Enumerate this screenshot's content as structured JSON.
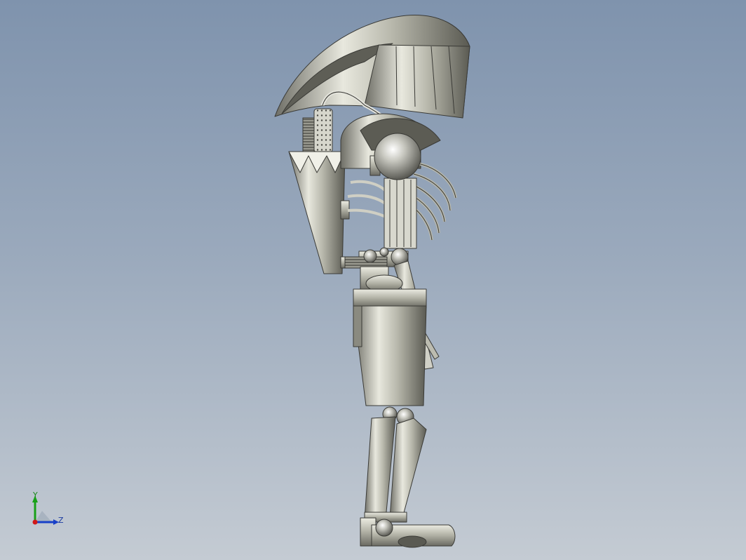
{
  "viewport": {
    "background_top": "#7f93ad",
    "background_bottom": "#c4cbd3"
  },
  "model": {
    "name": "battle-droid-side-view",
    "material_color": "#c8c8bc",
    "edge_color": "#3a3a36"
  },
  "triad": {
    "y_label": "Y",
    "z_label": "Z",
    "x_color": "#d01818",
    "y_color": "#18a018",
    "z_color": "#1840c8"
  }
}
